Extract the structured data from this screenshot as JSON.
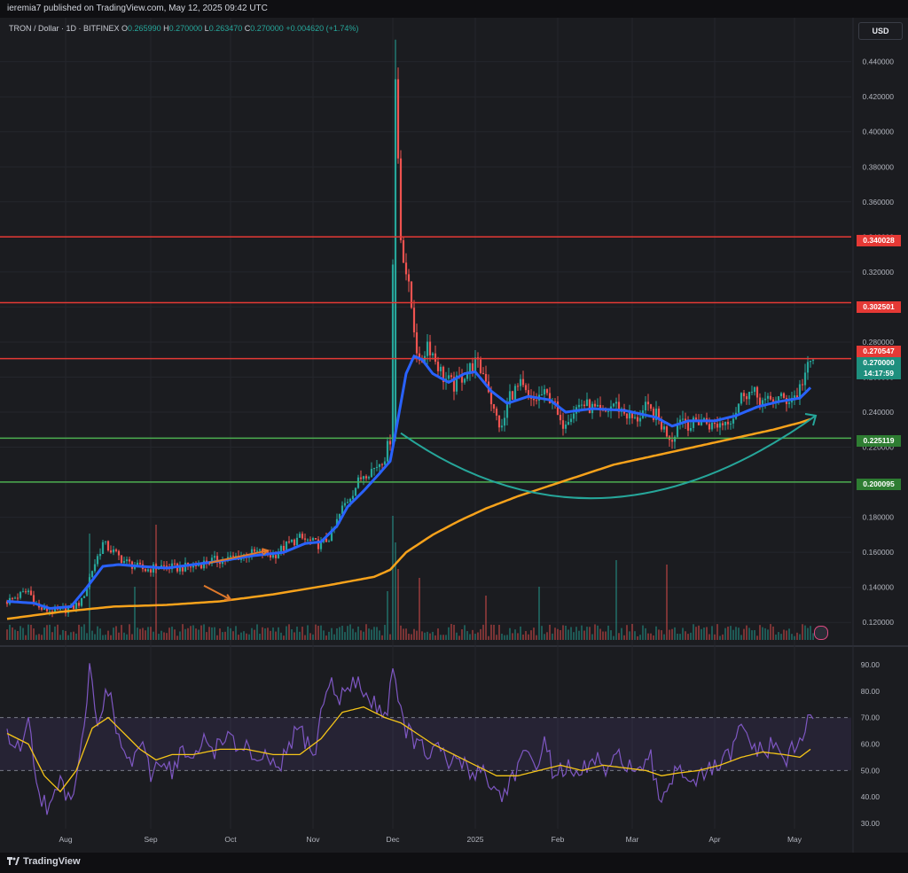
{
  "header": {
    "published": "ieremia7 published on TradingView.com, May 12, 2025 09:42 UTC"
  },
  "symbol": {
    "name": "TRON / Dollar · 1D · BITFINEX",
    "o_label": "O",
    "o": "0.265990",
    "h_label": "H",
    "h": "0.270000",
    "l_label": "L",
    "l": "0.263470",
    "c_label": "C",
    "c": "0.270000",
    "change": "+0.004620 (+1.74%)"
  },
  "currency": "USD",
  "brand": "TradingView",
  "price_labels": [
    {
      "text": "0.340028",
      "kind": "red"
    },
    {
      "text": "0.302501",
      "kind": "red"
    },
    {
      "text": "0.270547",
      "kind": "red"
    },
    {
      "text": "0.270000",
      "kind": "teal"
    },
    {
      "text": "14:17:59",
      "kind": "teal"
    },
    {
      "text": "0.225119",
      "kind": "green"
    },
    {
      "text": "0.200095",
      "kind": "green"
    }
  ],
  "colors": {
    "up": "#26a69a",
    "down": "#ef5350",
    "ema_fast": "#2962ff",
    "ema_slow": "#f7a21b",
    "resistance": "#e53935",
    "support": "#4caf50",
    "rsi": "#7e57c2",
    "rsi_ma": "#f5c518",
    "arrow": "#26a69a",
    "arrow_small": "#e0792b"
  },
  "chart_data": [
    {
      "type": "candlestick",
      "title": "TRON / Dollar · 1D · BITFINEX",
      "x_tick_labels": [
        "Aug",
        "Sep",
        "Oct",
        "Nov",
        "Dec",
        "2025",
        "Feb",
        "Mar",
        "Apr",
        "May"
      ],
      "x_ticks_day": [
        22,
        54,
        84,
        115,
        145,
        176,
        207,
        235,
        266,
        296
      ],
      "ylim": [
        0.11,
        0.455
      ],
      "y_ticks": [
        "0.440000",
        "0.420000",
        "0.400000",
        "0.380000",
        "0.360000",
        "0.340000",
        "0.320000",
        "0.300000",
        "0.280000",
        "0.260000",
        "0.240000",
        "0.220000",
        "0.200000",
        "0.180000",
        "0.160000",
        "0.140000",
        "0.120000"
      ],
      "horizontal_levels": [
        {
          "value": 0.340028,
          "color": "resistance"
        },
        {
          "value": 0.302501,
          "color": "resistance"
        },
        {
          "value": 0.270547,
          "color": "resistance"
        },
        {
          "value": 0.225119,
          "color": "support"
        },
        {
          "value": 0.200095,
          "color": "support"
        }
      ],
      "close_anchors": [
        [
          0,
          0.132
        ],
        [
          8,
          0.138
        ],
        [
          12,
          0.128
        ],
        [
          18,
          0.126
        ],
        [
          24,
          0.128
        ],
        [
          28,
          0.132
        ],
        [
          32,
          0.15
        ],
        [
          36,
          0.165
        ],
        [
          40,
          0.16
        ],
        [
          44,
          0.155
        ],
        [
          48,
          0.152
        ],
        [
          52,
          0.15
        ],
        [
          58,
          0.152
        ],
        [
          64,
          0.151
        ],
        [
          70,
          0.152
        ],
        [
          76,
          0.155
        ],
        [
          82,
          0.156
        ],
        [
          88,
          0.158
        ],
        [
          94,
          0.16
        ],
        [
          100,
          0.158
        ],
        [
          106,
          0.165
        ],
        [
          110,
          0.168
        ],
        [
          114,
          0.166
        ],
        [
          118,
          0.164
        ],
        [
          122,
          0.17
        ],
        [
          126,
          0.185
        ],
        [
          130,
          0.195
        ],
        [
          134,
          0.205
        ],
        [
          138,
          0.208
        ],
        [
          142,
          0.215
        ],
        [
          144,
          0.225
        ],
        [
          146,
          0.43
        ],
        [
          148,
          0.34
        ],
        [
          150,
          0.32
        ],
        [
          152,
          0.3
        ],
        [
          155,
          0.265
        ],
        [
          158,
          0.28
        ],
        [
          161,
          0.27
        ],
        [
          164,
          0.26
        ],
        [
          168,
          0.255
        ],
        [
          172,
          0.262
        ],
        [
          176,
          0.268
        ],
        [
          180,
          0.26
        ],
        [
          183,
          0.24
        ],
        [
          186,
          0.23
        ],
        [
          189,
          0.25
        ],
        [
          193,
          0.255
        ],
        [
          197,
          0.245
        ],
        [
          201,
          0.25
        ],
        [
          205,
          0.248
        ],
        [
          208,
          0.232
        ],
        [
          212,
          0.24
        ],
        [
          216,
          0.245
        ],
        [
          220,
          0.242
        ],
        [
          224,
          0.238
        ],
        [
          228,
          0.245
        ],
        [
          232,
          0.24
        ],
        [
          236,
          0.235
        ],
        [
          240,
          0.242
        ],
        [
          244,
          0.238
        ],
        [
          247,
          0.23
        ],
        [
          250,
          0.225
        ],
        [
          253,
          0.238
        ],
        [
          257,
          0.232
        ],
        [
          261,
          0.236
        ],
        [
          265,
          0.232
        ],
        [
          269,
          0.234
        ],
        [
          273,
          0.238
        ],
        [
          277,
          0.252
        ],
        [
          281,
          0.25
        ],
        [
          285,
          0.245
        ],
        [
          289,
          0.248
        ],
        [
          293,
          0.247
        ],
        [
          297,
          0.25
        ],
        [
          300,
          0.262
        ],
        [
          303,
          0.27
        ]
      ],
      "ema_fast": [
        [
          0,
          0.132
        ],
        [
          10,
          0.131
        ],
        [
          16,
          0.128
        ],
        [
          24,
          0.129
        ],
        [
          30,
          0.14
        ],
        [
          36,
          0.152
        ],
        [
          42,
          0.153
        ],
        [
          50,
          0.152
        ],
        [
          60,
          0.151
        ],
        [
          70,
          0.153
        ],
        [
          80,
          0.155
        ],
        [
          92,
          0.158
        ],
        [
          104,
          0.16
        ],
        [
          112,
          0.165
        ],
        [
          118,
          0.166
        ],
        [
          124,
          0.175
        ],
        [
          128,
          0.186
        ],
        [
          134,
          0.195
        ],
        [
          140,
          0.205
        ],
        [
          144,
          0.212
        ],
        [
          146,
          0.228
        ],
        [
          150,
          0.262
        ],
        [
          153,
          0.272
        ],
        [
          156,
          0.27
        ],
        [
          160,
          0.262
        ],
        [
          166,
          0.257
        ],
        [
          172,
          0.262
        ],
        [
          176,
          0.263
        ],
        [
          182,
          0.252
        ],
        [
          188,
          0.245
        ],
        [
          196,
          0.249
        ],
        [
          204,
          0.247
        ],
        [
          210,
          0.24
        ],
        [
          220,
          0.242
        ],
        [
          232,
          0.241
        ],
        [
          244,
          0.237
        ],
        [
          250,
          0.232
        ],
        [
          256,
          0.235
        ],
        [
          266,
          0.235
        ],
        [
          274,
          0.238
        ],
        [
          282,
          0.243
        ],
        [
          290,
          0.246
        ],
        [
          298,
          0.248
        ],
        [
          302,
          0.254
        ]
      ],
      "ema_slow": [
        [
          0,
          0.122
        ],
        [
          20,
          0.126
        ],
        [
          40,
          0.129
        ],
        [
          60,
          0.13
        ],
        [
          80,
          0.132
        ],
        [
          100,
          0.136
        ],
        [
          120,
          0.141
        ],
        [
          138,
          0.146
        ],
        [
          144,
          0.15
        ],
        [
          150,
          0.16
        ],
        [
          160,
          0.17
        ],
        [
          170,
          0.178
        ],
        [
          180,
          0.185
        ],
        [
          192,
          0.192
        ],
        [
          204,
          0.198
        ],
        [
          216,
          0.204
        ],
        [
          228,
          0.21
        ],
        [
          240,
          0.214
        ],
        [
          252,
          0.218
        ],
        [
          264,
          0.222
        ],
        [
          276,
          0.226
        ],
        [
          288,
          0.23
        ],
        [
          298,
          0.234
        ],
        [
          302,
          0.236
        ]
      ],
      "annotations": [
        {
          "type": "arc-arrow",
          "from": [
            148,
            0.228
          ],
          "mid": [
            224,
            0.191
          ],
          "to": [
            304,
            0.238
          ]
        },
        {
          "type": "arrow",
          "from": [
            76,
            0.154
          ],
          "to": [
            98,
            0.161
          ]
        },
        {
          "type": "arrow",
          "from": [
            74,
            0.141
          ],
          "to": [
            84,
            0.133
          ]
        }
      ]
    },
    {
      "type": "line",
      "title": "RSI",
      "ylim": [
        28,
        95
      ],
      "y_ticks": [
        "90.00",
        "80.00",
        "70.00",
        "60.00",
        "50.00",
        "40.00",
        "30.00"
      ],
      "overbought": 70,
      "oversold": 50,
      "rsi_anchors": [
        [
          0,
          64
        ],
        [
          4,
          58
        ],
        [
          8,
          68
        ],
        [
          12,
          42
        ],
        [
          16,
          35
        ],
        [
          20,
          45
        ],
        [
          24,
          40
        ],
        [
          28,
          60
        ],
        [
          31,
          88
        ],
        [
          34,
          70
        ],
        [
          38,
          80
        ],
        [
          42,
          62
        ],
        [
          46,
          52
        ],
        [
          50,
          60
        ],
        [
          54,
          48
        ],
        [
          58,
          55
        ],
        [
          62,
          50
        ],
        [
          66,
          58
        ],
        [
          70,
          52
        ],
        [
          74,
          62
        ],
        [
          78,
          58
        ],
        [
          82,
          64
        ],
        [
          86,
          58
        ],
        [
          90,
          60
        ],
        [
          94,
          50
        ],
        [
          98,
          56
        ],
        [
          102,
          48
        ],
        [
          106,
          60
        ],
        [
          110,
          66
        ],
        [
          112,
          62
        ],
        [
          116,
          56
        ],
        [
          118,
          72
        ],
        [
          121,
          84
        ],
        [
          124,
          78
        ],
        [
          128,
          80
        ],
        [
          132,
          84
        ],
        [
          136,
          76
        ],
        [
          140,
          74
        ],
        [
          143,
          72
        ],
        [
          145,
          92
        ],
        [
          147,
          74
        ],
        [
          150,
          66
        ],
        [
          154,
          60
        ],
        [
          158,
          56
        ],
        [
          162,
          58
        ],
        [
          166,
          52
        ],
        [
          170,
          55
        ],
        [
          174,
          48
        ],
        [
          178,
          52
        ],
        [
          182,
          44
        ],
        [
          186,
          40
        ],
        [
          190,
          48
        ],
        [
          194,
          55
        ],
        [
          198,
          52
        ],
        [
          202,
          60
        ],
        [
          206,
          48
        ],
        [
          210,
          52
        ],
        [
          214,
          46
        ],
        [
          218,
          52
        ],
        [
          222,
          54
        ],
        [
          226,
          48
        ],
        [
          230,
          56
        ],
        [
          234,
          52
        ],
        [
          238,
          48
        ],
        [
          242,
          54
        ],
        [
          245,
          38
        ],
        [
          248,
          44
        ],
        [
          252,
          52
        ],
        [
          256,
          48
        ],
        [
          260,
          46
        ],
        [
          264,
          50
        ],
        [
          268,
          52
        ],
        [
          272,
          56
        ],
        [
          276,
          66
        ],
        [
          280,
          60
        ],
        [
          284,
          56
        ],
        [
          288,
          60
        ],
        [
          292,
          54
        ],
        [
          296,
          58
        ],
        [
          299,
          62
        ],
        [
          302,
          72
        ]
      ],
      "rsi_ma": [
        [
          0,
          64
        ],
        [
          8,
          60
        ],
        [
          14,
          48
        ],
        [
          20,
          42
        ],
        [
          26,
          50
        ],
        [
          32,
          66
        ],
        [
          38,
          70
        ],
        [
          44,
          64
        ],
        [
          50,
          58
        ],
        [
          56,
          54
        ],
        [
          62,
          56
        ],
        [
          70,
          56
        ],
        [
          80,
          58
        ],
        [
          90,
          58
        ],
        [
          100,
          56
        ],
        [
          110,
          56
        ],
        [
          118,
          62
        ],
        [
          126,
          72
        ],
        [
          134,
          74
        ],
        [
          142,
          70
        ],
        [
          148,
          68
        ],
        [
          154,
          64
        ],
        [
          160,
          60
        ],
        [
          168,
          56
        ],
        [
          176,
          52
        ],
        [
          184,
          48
        ],
        [
          192,
          48
        ],
        [
          200,
          50
        ],
        [
          208,
          52
        ],
        [
          216,
          50
        ],
        [
          224,
          52
        ],
        [
          232,
          51
        ],
        [
          240,
          50
        ],
        [
          246,
          48
        ],
        [
          252,
          49
        ],
        [
          260,
          50
        ],
        [
          268,
          52
        ],
        [
          276,
          55
        ],
        [
          284,
          57
        ],
        [
          292,
          56
        ],
        [
          298,
          55
        ],
        [
          302,
          58
        ]
      ]
    }
  ]
}
